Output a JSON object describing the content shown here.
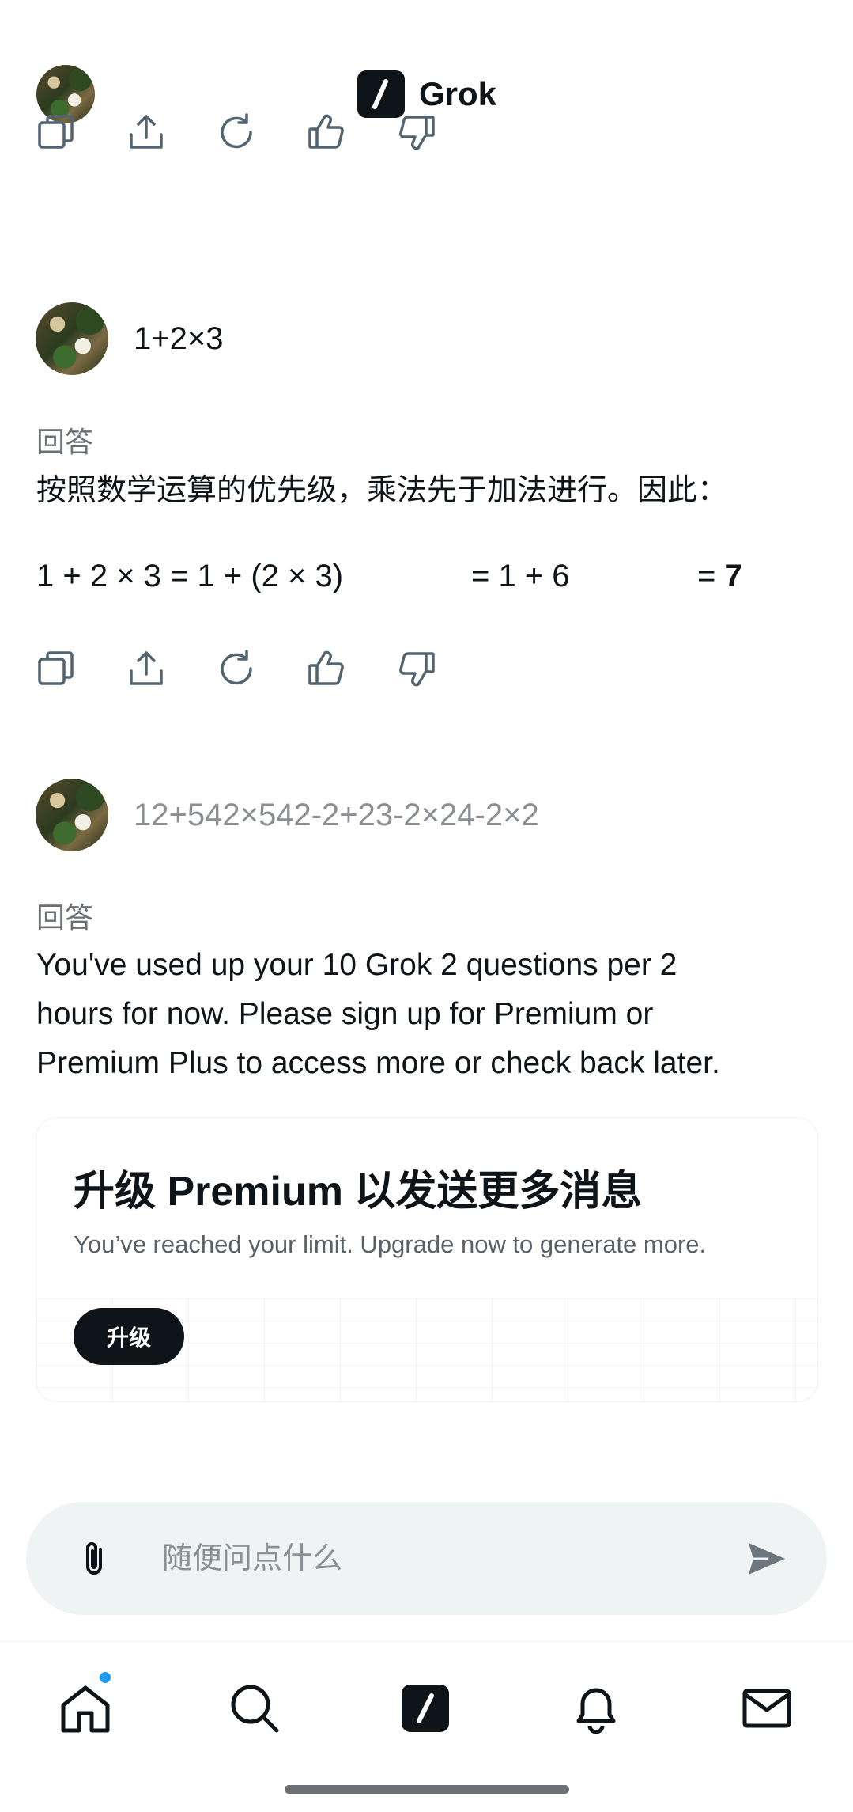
{
  "header": {
    "title": "Grok"
  },
  "conversation": [
    {
      "user_text": "1+2×3",
      "answer_label": "回答",
      "answer_text": "按照数学运算的优先级，乘法先于加法进行。因此：",
      "math": {
        "part1": "1 + 2 × 3 = 1 + (2 × 3)",
        "part2": "= 1 + 6",
        "part3_prefix": "= ",
        "part3_result": "7"
      }
    },
    {
      "user_text": "12+542×542-2+23-2×24-2×2",
      "answer_label": "回答",
      "answer_lines": [
        "You've used up your 10 Grok 2 questions per 2",
        "hours for now. Please sign up for Premium or",
        "Premium Plus to access more or check back later."
      ]
    }
  ],
  "premium_card": {
    "title": "升级 Premium 以发送更多消息",
    "subtitle": "You’ve reached your limit. Upgrade now to generate more.",
    "button_label": "升级"
  },
  "composer": {
    "placeholder": "随便问点什么"
  },
  "icons": {
    "actions": [
      "copy-icon",
      "share-icon",
      "regenerate-icon",
      "thumbs-up-icon",
      "thumbs-down-icon"
    ],
    "nav": [
      "home-icon",
      "search-icon",
      "grok-icon",
      "notifications-icon",
      "messages-icon"
    ]
  },
  "colors": {
    "text": "#0f1419",
    "muted": "#8b8f94",
    "composer_bg": "#eff3f4",
    "notification_dot": "#1d9bf0"
  }
}
